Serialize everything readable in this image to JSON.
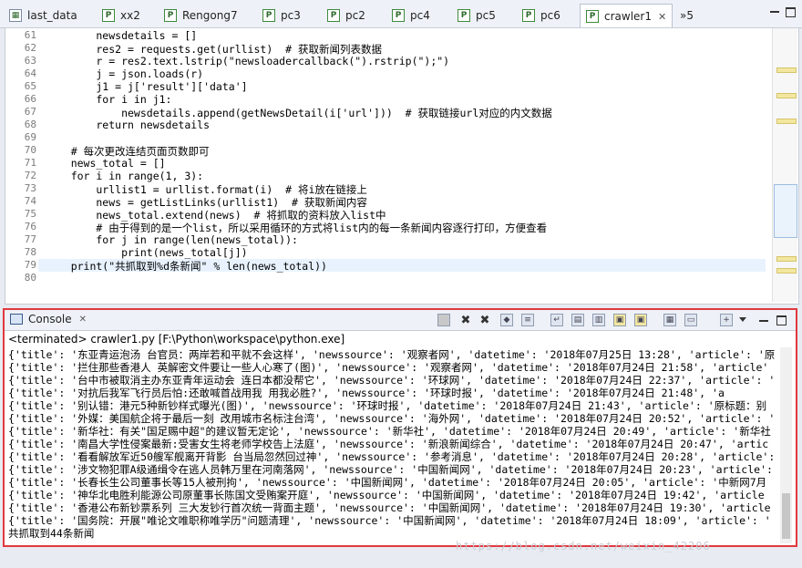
{
  "tabs": [
    {
      "label": "last_data",
      "icon": "sheet-icon"
    },
    {
      "label": "xx2",
      "icon": "python-file-icon"
    },
    {
      "label": "Rengong7",
      "icon": "python-file-icon"
    },
    {
      "label": "pc3",
      "icon": "python-file-icon"
    },
    {
      "label": "pc2",
      "icon": "python-file-icon"
    },
    {
      "label": "pc4",
      "icon": "python-file-icon"
    },
    {
      "label": "pc5",
      "icon": "python-file-icon"
    },
    {
      "label": "pc6",
      "icon": "python-file-icon"
    },
    {
      "label": "crawler1",
      "icon": "python-file-icon",
      "active": true
    }
  ],
  "tab_overflow": "»5",
  "editor": {
    "line_numbers": [
      "61",
      "62",
      "63",
      "64",
      "65",
      "66",
      "67",
      "68",
      "69",
      "70",
      "71",
      "72",
      "73",
      "74",
      "75",
      "76",
      "77",
      "78",
      "79",
      "80"
    ],
    "lines": [
      "        newsdetails = []",
      "        res2 = requests.get(urllist)  # 获取新闻列表数据",
      "        r = res2.text.lstrip(\"newsloadercallback(\").rstrip(\");\")",
      "        j = json.loads(r)",
      "        j1 = j['result']['data']",
      "        for i in j1:",
      "            newsdetails.append(getNewsDetail(i['url']))  # 获取链接url对应的内文数据",
      "        return newsdetails",
      "",
      "    # 每次更改连结页面页数即可",
      "    news_total = []",
      "    for i in range(1, 3):",
      "        urllist1 = urllist.format(i)  # 将i放在链接上",
      "        news = getListLinks(urllist1)  # 获取新闻内容",
      "        news_total.extend(news)  # 将抓取的资料放入list中",
      "        # 由于得到的是一个list，所以采用循环的方式将list内的每一条新闻内容逐行打印，方便查看",
      "        for j in range(len(news_total)):",
      "            print(news_total[j])",
      "    print(\"共抓取到%d条新闻\" % len(news_total))",
      ""
    ]
  },
  "console": {
    "title": "Console",
    "status": "<terminated> crawler1.py [F:\\Python\\workspace\\python.exe]",
    "lines": [
      "{'title': '东亚青运泡汤 台官员：两岸若和平就不会这样', 'newssource': '观察者网', 'datetime': '2018年07月25日 13:28', 'article': '原",
      "{'title': '拦住那些香港人 英解密文件要让一些人心寒了(图)', 'newssource': '观察者网', 'datetime': '2018年07月24日 21:58', 'article'",
      "{'title': '台中市被取消主办东亚青年运动会 连日本都没帮它', 'newssource': '环球网', 'datetime': '2018年07月24日 22:37', 'article': '",
      "{'title': '对抗后我军飞行员后怕:还敢喊首战用我 用我必胜?', 'newssource': '环球时报', 'datetime': '2018年07月24日 21:48', 'a",
      "{'title': '别认错：港元5种新钞样式曝光(图)', 'newssource': '环球时报', 'datetime': '2018年07月24日 21:43', 'article': '原标题：别",
      "{'title': '外媒：美国航企将于最后一刻 改用城市名标注台湾', 'newssource': '海外网', 'datetime': '2018年07月24日 20:52', 'article': '",
      "{'title': '新华社：有关\"国足赐中超\"的建议暂无定论', 'newssource': '新华社', 'datetime': '2018年07月24日 20:49', 'article': '新华社",
      "{'title': '南昌大学性侵案最新:受害女生将老师学校告上法庭', 'newssource': '新浪新闻综合', 'datetime': '2018年07月24日 20:47', 'artic",
      "{'title': '看看解放军近50艘军舰离开背影 台当局忽然回过神', 'newssource': '参考消息', 'datetime': '2018年07月24日 20:28', 'article': '",
      "{'title': '涉文物犯罪A级通缉令在逃人员韩万里在河南落网', 'newssource': '中国新闻网', 'datetime': '2018年07月24日 20:23', 'article':",
      "{'title': '长春长生公司董事长等15人被刑拘', 'newssource': '中国新闻网', 'datetime': '2018年07月24日 20:05', 'article': '中新网7月",
      "{'title': '神华北电胜利能源公司原董事长陈国文受贿案开庭', 'newssource': '中国新闻网', 'datetime': '2018年07月24日 19:42', 'article",
      "{'title': '香港公布新钞票系列 三大发钞行首次统一背面主题', 'newssource': '中国新闻网', 'datetime': '2018年07月24日 19:30', 'article",
      "{'title': '国务院：开展\"唯论文唯职称唯学历\"问题清理', 'newssource': '中国新闻网', 'datetime': '2018年07月24日 18:09', 'article': '",
      "共抓取到44条新闻"
    ]
  },
  "watermark": "https://blog.csdn.net/weixin_42206"
}
